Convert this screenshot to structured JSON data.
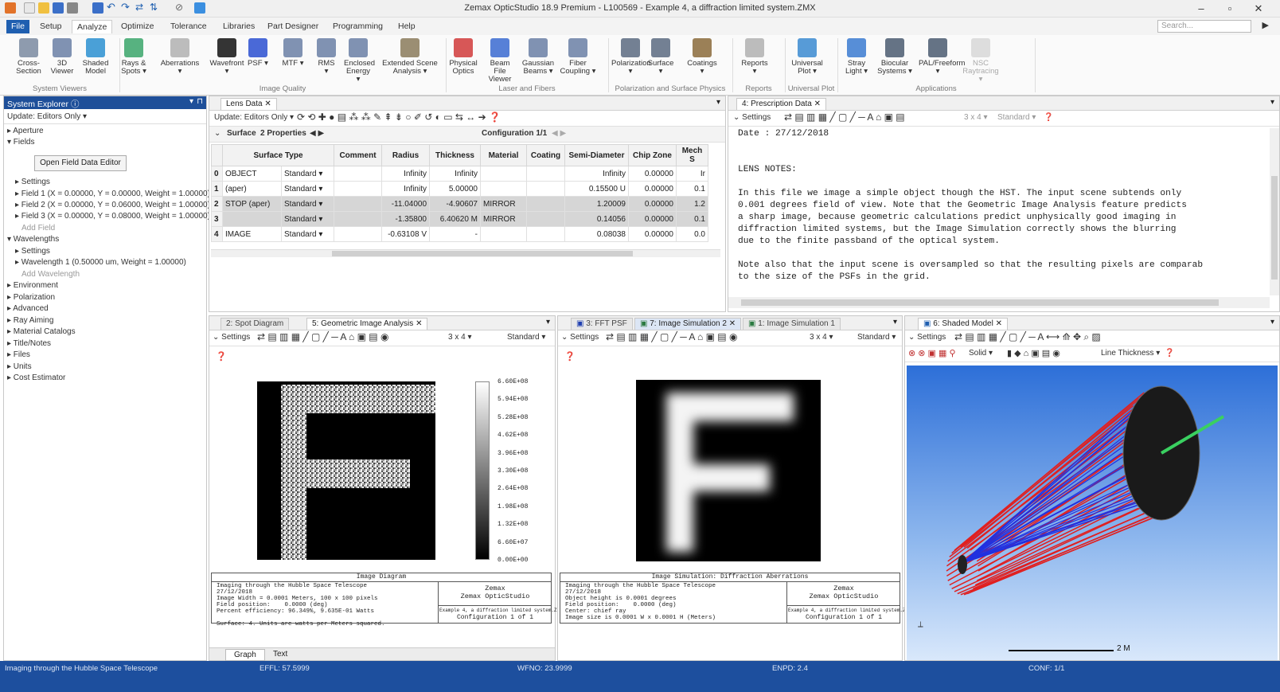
{
  "window": {
    "title": "Zemax OpticStudio 18.9   Premium - L100569 - Example 4, a diffraction limited system.ZMX",
    "minimize": "–",
    "maximize": "▫",
    "close": "✕"
  },
  "menu": {
    "tabs": [
      "File",
      "Setup",
      "Analyze",
      "Optimize",
      "Tolerance",
      "Libraries",
      "Part Designer",
      "Programming",
      "Help"
    ],
    "active": "Analyze",
    "search_placeholder": "Search..."
  },
  "ribbon": {
    "buttons": [
      {
        "label": "Cross-Section",
        "icon": "cross-section-icon",
        "color": "#7a8aa0"
      },
      {
        "label": "3D Viewer",
        "icon": "3d-viewer-icon",
        "color": "#6a7fa5"
      },
      {
        "label": "Shaded Model",
        "icon": "shaded-model-icon",
        "color": "#2a8fd0"
      },
      {
        "label": "Rays & Spots ▾",
        "icon": "rays-spots-icon",
        "color": "#3aa56a"
      },
      {
        "label": "Aberrations ▾",
        "icon": "aberrations-icon",
        "color": "#b0b0b0"
      },
      {
        "label": "Wavefront ▾",
        "icon": "wavefront-icon",
        "color": "#111111"
      },
      {
        "label": "PSF ▾",
        "icon": "psf-icon",
        "color": "#2a4fd0"
      },
      {
        "label": "MTF ▾",
        "icon": "mtf-icon",
        "color": "#6a7fa5"
      },
      {
        "label": "RMS ▾",
        "icon": "rms-icon",
        "color": "#6a7fa5"
      },
      {
        "label": "Enclosed Energy ▾",
        "icon": "enclosed-energy-icon",
        "color": "#6a7fa5"
      },
      {
        "label": "Extended Scene Analysis ▾",
        "icon": "extended-scene-icon",
        "color": "#8a7a5a"
      },
      {
        "label": "Physical Optics",
        "icon": "physical-optics-icon",
        "color": "#d03a3a"
      },
      {
        "label": "Beam File Viewer",
        "icon": "beam-file-icon",
        "color": "#3a6ad0"
      },
      {
        "label": "Gaussian Beams ▾",
        "icon": "gaussian-icon",
        "color": "#6a7fa5"
      },
      {
        "label": "Fiber Coupling ▾",
        "icon": "fiber-icon",
        "color": "#6a7fa5"
      },
      {
        "label": "Polarization ▾",
        "icon": "polarization-icon",
        "color": "#5a6a80"
      },
      {
        "label": "Surface ▾",
        "icon": "surface-icon",
        "color": "#5a6a80"
      },
      {
        "label": "Coatings ▾",
        "icon": "coatings-icon",
        "color": "#8a6a3a"
      },
      {
        "label": "Reports ▾",
        "icon": "reports-icon",
        "color": "#b0b0b0"
      },
      {
        "label": "Universal Plot ▾",
        "icon": "universal-plot-icon",
        "color": "#3a8ad0"
      },
      {
        "label": "Stray Light ▾",
        "icon": "stray-light-icon",
        "color": "#3a7ad0"
      },
      {
        "label": "Biocular Systems ▾",
        "icon": "biocular-icon",
        "color": "#4a5a70"
      },
      {
        "label": "PAL/Freeform ▾",
        "icon": "pal-icon",
        "color": "#4a5a70"
      },
      {
        "label": "NSC Raytracing ▾",
        "icon": "nsc-icon",
        "color": "#c0c0c0"
      }
    ],
    "groups": [
      "System Viewers",
      "Image Quality",
      "Laser and Fibers",
      "Polarization and Surface Physics",
      "Reports",
      "Universal Plot",
      "Applications"
    ]
  },
  "system_explorer": {
    "title": "System Explorer ⓘ",
    "update": "Update: Editors Only ▾",
    "open_field_editor": "Open Field Data Editor",
    "items": [
      "▸ Aperture",
      "▾ Fields",
      "▸ Settings",
      "▸ Field 1 (X = 0.00000, Y = 0.00000, Weight = 1.00000)",
      "▸ Field 2 (X = 0.00000, Y = 0.06000, Weight = 1.00000)",
      "▸ Field 3 (X = 0.00000, Y = 0.08000, Weight = 1.00000)",
      "Add Field",
      "▾ Wavelengths",
      "▸ Settings",
      "▸ Wavelength 1 (0.50000 um, Weight = 1.00000)",
      "Add Wavelength",
      "▸ Environment",
      "▸ Polarization",
      "▸ Advanced",
      "▸ Ray Aiming",
      "▸ Material Catalogs",
      "▸ Title/Notes",
      "▸ Files",
      "▸ Units",
      "▸ Cost Estimator"
    ]
  },
  "lens_data": {
    "tab": "Lens Data",
    "update": "Update: Editors Only ▾",
    "surface_label": "Surface",
    "properties": "2 Properties",
    "configuration": "Configuration 1/1",
    "columns": [
      "",
      "Surface Type",
      "Comment",
      "Radius",
      "Thickness",
      "Material",
      "Coating",
      "Semi-Diameter",
      "Chip Zone",
      "Mech S"
    ],
    "rows": [
      [
        "0",
        "OBJECT",
        "Standard ▾",
        "",
        "Infinity",
        "Infinity",
        "",
        "",
        "Infinity",
        "0.00000",
        "Ir"
      ],
      [
        "1",
        "(aper)",
        "Standard ▾",
        "",
        "Infinity",
        "5.00000",
        "",
        "",
        "0.15500  U",
        "0.00000",
        "0.1"
      ],
      [
        "2",
        "STOP (aper)",
        "Standard ▾",
        "",
        "-11.04000",
        "-4.90607",
        "MIRROR",
        "",
        "1.20009",
        "0.00000",
        "1.2"
      ],
      [
        "3",
        "",
        "Standard ▾",
        "",
        "-1.35800",
        "6.40620  M",
        "MIRROR",
        "",
        "0.14056",
        "0.00000",
        "0.1"
      ],
      [
        "4",
        "IMAGE",
        "Standard ▾",
        "",
        "-0.63108  V",
        "-",
        "",
        "",
        "0.08038",
        "0.00000",
        "0.0"
      ]
    ]
  },
  "prescription": {
    "tab": "4: Prescription Data",
    "settings": "Settings",
    "grid": "3 x 4 ▾",
    "standard": "Standard ▾",
    "lines": [
      "Date : 27/12/2018",
      "",
      "",
      "LENS NOTES:",
      "",
      "In this file we image a simple object though the HST. The input scene subtends only",
      "0.001 degrees field of view. Note that the Geometric Image Analysis feature predicts",
      "a sharp image, because geometric calculations predict unphysically good imaging in",
      "diffraction limited systems, but the Image Simulation correctly shows the blurring",
      "due to the finite passband of the optical system.",
      "",
      "Note also that the input scene is oversampled so that the resulting pixels are comparab",
      "to the size of the PSFs in the grid."
    ]
  },
  "geo_pane": {
    "tabs": [
      "2: Spot Diagram",
      "5: Geometric Image Analysis"
    ],
    "settings": "Settings",
    "grid": "3 x 4 ▾",
    "standard": "Standard ▾",
    "scale": [
      "6.60E+08",
      "5.94E+08",
      "5.28E+08",
      "4.62E+08",
      "3.96E+08",
      "3.30E+08",
      "2.64E+08",
      "1.98E+08",
      "1.32E+08",
      "6.60E+07",
      "0.00E+00"
    ],
    "footer_title": "Image Diagram",
    "footer_left": "Imaging through the Hubble Space Telescope\n27/12/2018\nImage Width = 0.0001 Meters, 100 x 100 pixels\nField position:    0.0000 (deg)\nPercent efficiency: 96.349%, 9.635E-01 Watts\n\nSurface: 4. Units are watts per Meters squared.",
    "footer_brand": "Zemax\nZemax OpticStudio",
    "footer_file": "Example 4, a diffraction limited system.ZMX",
    "footer_config": "Configuration 1 of 1",
    "bottom_tabs": [
      "Graph",
      "Text"
    ]
  },
  "sim_pane": {
    "tabs": [
      "3: FFT PSF",
      "7: Image Simulation 2",
      "1: Image Simulation 1"
    ],
    "settings": "Settings",
    "grid": "3 x 4 ▾",
    "standard": "Standard ▾",
    "footer_title": "Image Simulation: Diffraction Aberrations",
    "footer_left": "Imaging through the Hubble Space Telescope\n27/12/2018\nObject height is 0.0001 degrees\nField position:    0.0000 (deg)\nCenter: chief ray\nImage size is 0.0001 W x 0.0001 H (Meters)",
    "footer_brand": "Zemax\nZemax OpticStudio",
    "footer_file": "Example 4, a diffraction limited system.ZMX",
    "footer_config": "Configuration 1 of 1"
  },
  "shaded_pane": {
    "tab": "6: Shaded Model",
    "settings": "Settings",
    "solid": "Solid ▾",
    "line_thickness": "Line Thickness ▾",
    "scale_label": "2 M",
    "colors": {
      "ray_red": "#e02020",
      "ray_blue": "#2030e0",
      "bg_top": "#2d6fd8",
      "bg_bottom": "#d9e8fb"
    }
  },
  "status": {
    "left": "Imaging through the Hubble Space Telescope",
    "effl": "EFFL: 57.5999",
    "wfno": "WFNO: 23.9999",
    "enpd": "ENPD: 2.4",
    "conf": "CONF: 1/1"
  }
}
